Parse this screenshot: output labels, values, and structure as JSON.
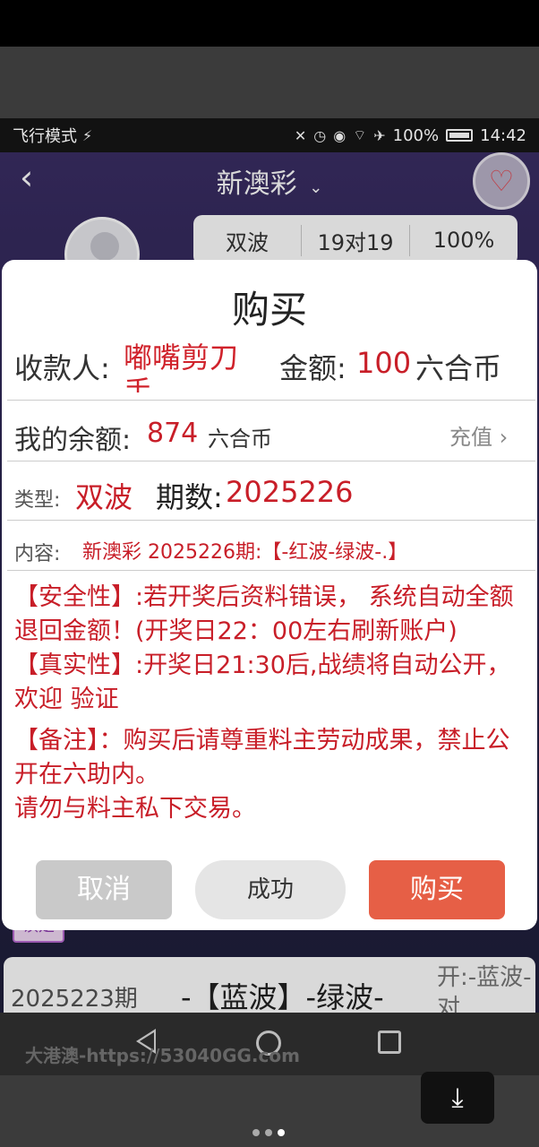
{
  "status_bar": {
    "left_text": "飞行模式",
    "battery": "100%",
    "time": "14:42"
  },
  "nav": {
    "title": "新澳彩",
    "chevron": "⌄",
    "back_icon": "chevron-left-icon",
    "favorite_icon": "heart-icon"
  },
  "stats": [
    {
      "label": "双波"
    },
    {
      "label": "19对19"
    },
    {
      "label": "100%"
    }
  ],
  "modal": {
    "title": "购买",
    "payee_label": "收款人:",
    "payee_name": "嘟嘴剪刀手",
    "amount_label": "金额:",
    "amount_value": "100",
    "amount_unit": "六合币",
    "balance_label": "我的余额:",
    "balance_value": "874",
    "balance_unit": "六合币",
    "recharge_label": "充值",
    "type_label": "类型:",
    "type_value": "双波",
    "period_label": "期数:",
    "period_value": "2025226",
    "content_label": "内容:",
    "content_value": "新澳彩 2025226期:【-红波-绿波-.】",
    "notes": [
      "【安全性】:若开奖后资料错误， 系统自动全额退回金额！(开奖日22：00左右刷新账户)",
      "【真实性】:开奖日21:30后,战绩将自动公开，欢迎 验证",
      "【备注】：购买后请尊重料主劳动成果，禁止公开在六助内。",
      "请勿与料主私下交易。"
    ],
    "cancel_label": "取消",
    "success_label": "成功",
    "buy_label": "购买"
  },
  "background_list": {
    "tag": "读是",
    "record": {
      "period": "2025223期",
      "content": "-【蓝波】-绿波-",
      "open": "开:-蓝波-对"
    }
  },
  "bottom_watermark": "大港澳-https://53040GG.com",
  "colors": {
    "accent_red": "#c81e28",
    "buy_button": "#e65f46",
    "cancel_button": "#c9c9c9"
  }
}
